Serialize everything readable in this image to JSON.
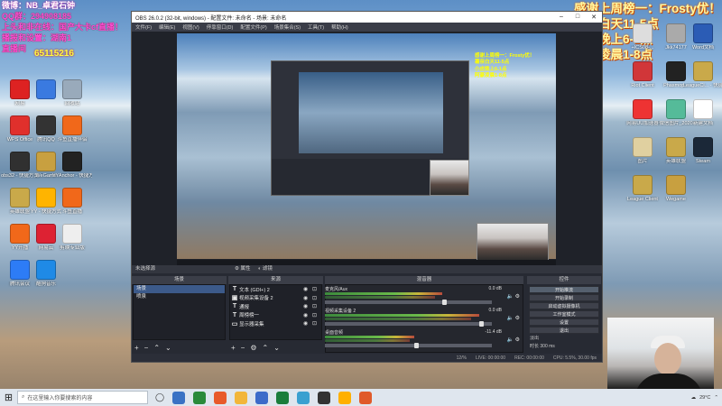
{
  "overlay_left": [
    {
      "text": "微博：NB_卓君石钟",
      "color": "#ffffff"
    },
    {
      "text": "QQ群：294908185",
      "color": "#ff4fd8"
    },
    {
      "text": "上头和非在线：国产大卡cf直播！",
      "color": "#ff4fd8"
    },
    {
      "text": "播报和设置：湖南1",
      "color": "#ff4fd8"
    },
    {
      "text": "直播间",
      "color": "#ff4fd8"
    },
    {
      "text": "65115216",
      "color": "#ff4fd8"
    }
  ],
  "overlay_right": [
    "感谢上周榜一：Frosty优！",
    "薯奈白天11-5点",
    "小皮晚上6-1点",
    "阿豪凌晨1-8点"
  ],
  "desktop_icons_left": [
    {
      "label": "网易",
      "color": "#d22"
    },
    {
      "label": "",
      "color": "#3a7ae0"
    },
    {
      "label": "回收站",
      "color": "#9ab"
    },
    {
      "label": "WPS Office",
      "color": "#e0302c"
    },
    {
      "label": "腾讯QQ",
      "color": "#333"
    },
    {
      "label": "斗鱼直播伴侣",
      "color": "#f1681a"
    },
    {
      "label": "obs32 - 快捷方式",
      "color": "#303030"
    },
    {
      "label": "WeGame",
      "color": "#c8a040"
    },
    {
      "label": "YYAnchor - 快捷方式",
      "color": "#222"
    },
    {
      "label": "英雄联盟",
      "color": "#c9a94a"
    },
    {
      "label": "YY - 快捷方式",
      "color": "#ffb400"
    },
    {
      "label": "斗鱼直播",
      "color": "#f1681a"
    },
    {
      "label": "YY开播",
      "color": "#f1681a"
    },
    {
      "label": "网易云",
      "color": "#d23"
    },
    {
      "label": "剪映专业版",
      "color": "#eee"
    },
    {
      "label": "腾讯会议",
      "color": "#2d7cf6"
    },
    {
      "label": "酷狗音乐",
      "color": "#1f8ae6"
    }
  ],
  "desktop_icons_right": [
    {
      "label": "+ICS08-...",
      "color": "#ddd"
    },
    {
      "label": "Jkk74177",
      "color": "#aaa"
    },
    {
      "label": "Word文档",
      "color": "#2b5cb5"
    },
    {
      "label": "Riot Client",
      "color": "#d13639"
    },
    {
      "label": "Phasmop...",
      "color": "#222"
    },
    {
      "label": "LeagueCl... - 快捷方式",
      "color": "#c9a94a"
    },
    {
      "label": "网易UU加速器",
      "color": "#e33"
    },
    {
      "label": "微信图片_2020",
      "color": "#5b9"
    },
    {
      "label": "新建文档",
      "color": "#fff"
    },
    {
      "label": "图片",
      "color": "#e0d0a0"
    },
    {
      "label": "英雄联盟",
      "color": "#c9a94a"
    },
    {
      "label": "Steam",
      "color": "#1b2838"
    },
    {
      "label": "League Client",
      "color": "#c9a94a"
    },
    {
      "label": "Wegame",
      "color": "#c8a040"
    }
  ],
  "obs": {
    "title": "OBS 26.0.2 (32-bit, windows) - 配置文件: 未命名 - 场景: 未命名",
    "menu": [
      "文件(F)",
      "编辑(E)",
      "视图(V)",
      "停靠窗口(D)",
      "配置文件(P)",
      "场景集合(S)",
      "工具(T)",
      "帮助(H)"
    ],
    "nested_overlay": [
      "感谢上周榜一：Frosty优！",
      "薯奈白天11-5点",
      "小皮晚上6-1点",
      "阿豪凌晨1-8点"
    ],
    "no_source": "未选择源",
    "toolbar_props": "属性",
    "toolbar_filters": "滤镜",
    "scenes": {
      "title": "场景",
      "items": [
        "场景",
        "喷泉"
      ]
    },
    "sources": {
      "title": "来源",
      "items": [
        {
          "type": "T",
          "name": "文本 (GDI+) 2"
        },
        {
          "type": "▣",
          "name": "视频采集设备 2"
        },
        {
          "type": "T",
          "name": "通报"
        },
        {
          "type": "T",
          "name": "周榜榜一"
        },
        {
          "type": "▭",
          "name": "显示器采集"
        }
      ]
    },
    "mixer": {
      "title": "混音器",
      "channels": [
        {
          "name": "麦克风/Aux",
          "db": "0.0 dB",
          "level": 0.72
        },
        {
          "name": "视频采集设备 2",
          "db": "0.0 dB",
          "level": 0.95
        },
        {
          "name": "桌面音频",
          "db": "-11.4 dB",
          "level": 0.55
        }
      ]
    },
    "controls": {
      "title": "控件",
      "buttons": [
        "开始推流",
        "开始录制",
        "启动虚拟摄像机",
        "工作室模式",
        "设置",
        "退出"
      ]
    },
    "transition": {
      "label": "淡出",
      "duration_label": "时长",
      "duration": "300 ms"
    },
    "status": {
      "live": "LIVE: 00:00:00",
      "rec": "REC: 00:00:00",
      "cpu": "CPU: 5.5%, 30.00 fps",
      "dropped": "12/%"
    }
  },
  "taskbar": {
    "search_placeholder": "在这里输入你要搜索的内容",
    "apps": [
      "#3a72c4",
      "#2a8a3a",
      "#e85a2a",
      "#f2b63a",
      "#3c6bc9",
      "#1b7d3b",
      "#3aa0d0",
      "#333333",
      "#ffb000",
      "#e05a2a"
    ],
    "temp": "29°C"
  }
}
